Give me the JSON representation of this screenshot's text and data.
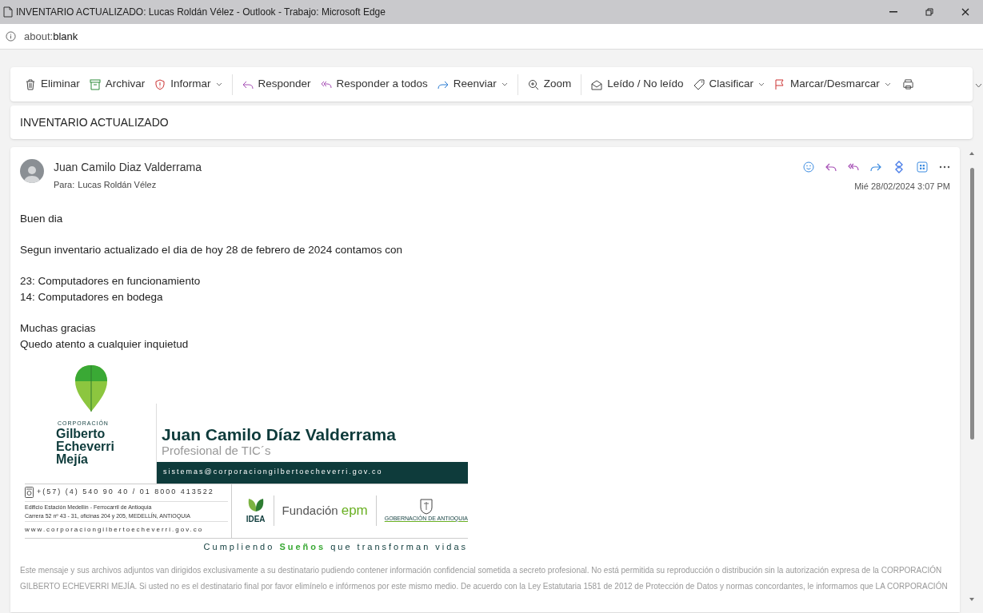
{
  "window": {
    "title": "INVENTARIO ACTUALIZADO: Lucas Roldán Vélez - Outlook - Trabajo: Microsoft Edge",
    "address": "about:",
    "address_bold": "blank"
  },
  "toolbar": [
    {
      "label": "Eliminar",
      "has_menu": false
    },
    {
      "label": "Archivar",
      "has_menu": false
    },
    {
      "label": "Informar",
      "has_menu": true
    },
    {
      "label": "Responder",
      "has_menu": false
    },
    {
      "label": "Responder a todos",
      "has_menu": false
    },
    {
      "label": "Reenviar",
      "has_menu": true
    },
    {
      "label": "Zoom",
      "has_menu": false
    },
    {
      "label": "Leído / No leído",
      "has_menu": false
    },
    {
      "label": "Clasificar",
      "has_menu": true
    },
    {
      "label": "Marcar/Desmarcar",
      "has_menu": true
    }
  ],
  "subject": "INVENTARIO ACTUALIZADO",
  "message": {
    "sender": "Juan Camilo Diaz Valderrama",
    "to_label": "Para:",
    "to": "Lucas Roldán Vélez",
    "date": "Mié 28/02/2024 3:07 PM",
    "body": [
      "Buen dia",
      "Segun inventario actualizado el dia de hoy 28 de febrero de 2024 contamos con",
      "23: Computadores en funcionamiento\n14: Computadores en bodega",
      "Muchas gracias\nQuedo atento a cualquier inquietud"
    ],
    "signature": {
      "org_small": "CORPORACIÓN",
      "org_lines": [
        "Gilberto",
        "Echeverri",
        "Mejía"
      ],
      "name": "Juan Camilo Díaz Valderrama",
      "role": "Profesional de TIC´s",
      "email": "sistemas@corporaciongilbertoecheverri.gov.co",
      "phone": "+(57) (4) 540 90 40 / 01 8000 413522",
      "address": [
        "Edificio Estación Medellín - Ferrocarril de Antioquia",
        "Carrera 52 nº 43 - 31, oficinas 204 y 205, MEDELLÍN, ANTIOQUIA"
      ],
      "web": "www.corporaciongilbertoecheverri.gov.co",
      "partners": [
        "IDEA",
        "Fundación",
        "epm",
        "GOBERNACIÓN DE ANTIOQUIA"
      ],
      "slogan": "Cumpliendo **Sueños** que transforman vidas"
    },
    "disclaimer": [
      "Este mensaje y sus archivos adjuntos van dirigidos exclusivamente a su destinatario pudiendo contener información confidencial sometida a secreto profesional. No está permitida su reproducción o distribución sin la autorización expresa de la CORPORACIÓN",
      "GILBERTO ECHEVERRI MEJÍA. Si usted no es el destinatario final por favor elimínelo e infórmenos por este mismo medio. De acuerdo con la Ley Estatutaria 1581 de 2012 de Protección de Datos y normas concordantes, le informamos que LA CORPORACIÓN"
    ]
  }
}
